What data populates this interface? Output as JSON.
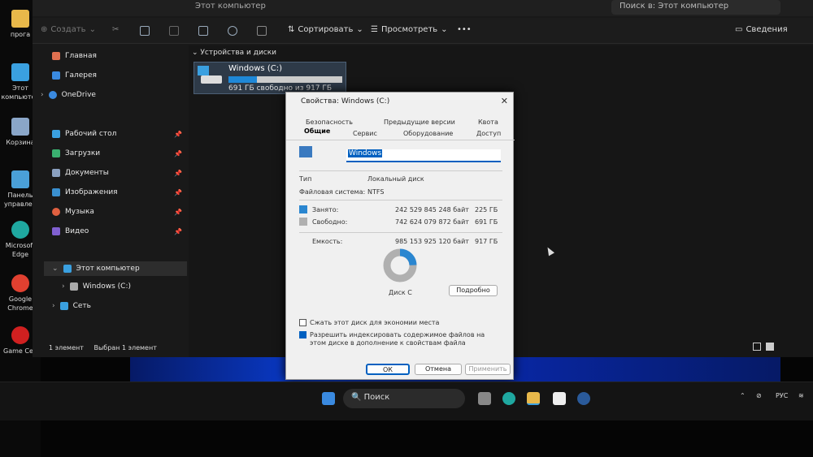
{
  "desktop": {
    "icons": [
      {
        "label": "прога",
        "icon": "folder-icon",
        "color": "#e8b84a"
      },
      {
        "label": "Этот компьютер",
        "icon": "computer-icon",
        "color": "#3aa0e0"
      },
      {
        "label": "Корзина",
        "icon": "recycle-bin-icon",
        "color": "#8aa6c8"
      },
      {
        "label": "Панель управлен",
        "icon": "control-panel-icon",
        "color": "#4aa0d8"
      },
      {
        "label": "Microsoft Edge",
        "icon": "edge-icon",
        "color": "#1fa8a0"
      },
      {
        "label": "Google Chrome",
        "icon": "chrome-icon",
        "color": "#e04030"
      },
      {
        "label": "Game Cen",
        "icon": "game-center-icon",
        "color": "#d02020"
      }
    ]
  },
  "explorer": {
    "title": "Этот компьютер",
    "search_placeholder": "Поиск в: Этот компьютер",
    "toolbar": {
      "create": "Создать",
      "sort": "Сортировать",
      "view": "Просмотреть",
      "more": "•••",
      "details": "Сведения"
    },
    "sidebar": {
      "items": [
        {
          "label": "Главная",
          "color": "#e07050"
        },
        {
          "label": "Галерея",
          "color": "#3a8ae0"
        },
        {
          "label": "OneDrive",
          "color": "#3a8ae0"
        },
        {
          "label": "Рабочий стол",
          "color": "#3aa0e0"
        },
        {
          "label": "Загрузки",
          "color": "#3ab070"
        },
        {
          "label": "Документы",
          "color": "#8aa0c0"
        },
        {
          "label": "Изображения",
          "color": "#3a90d0"
        },
        {
          "label": "Музыка",
          "color": "#e06040"
        },
        {
          "label": "Видео",
          "color": "#8060d0"
        },
        {
          "label": "Этот компьютер",
          "color": "#3aa0e0"
        },
        {
          "label": "Windows (C:)",
          "color": "#aaaaaa"
        },
        {
          "label": "Сеть",
          "color": "#3aa0e0"
        }
      ]
    },
    "section_title": "Устройства и диски",
    "drive": {
      "name": "Windows (C:)",
      "free_text": "691 ГБ свободно из 917 ГБ",
      "used_fraction": 0.25
    },
    "status": {
      "count": "1 элемент",
      "selected": "Выбран 1 элемент"
    }
  },
  "dialog": {
    "title": "Свойства: Windows (C:)",
    "tabs_row1": [
      "Безопасность",
      "Предыдущие версии",
      "Квота"
    ],
    "tabs_row2": [
      "Общие",
      "Сервис",
      "Оборудование",
      "Доступ"
    ],
    "name_value": "Windows",
    "type_label": "Тип",
    "type_value": "Локальный диск",
    "fs_label": "Файловая система:",
    "fs_value": "NTFS",
    "used_label": "Занято:",
    "used_bytes": "242 529 845 248 байт",
    "used_size": "225 ГБ",
    "free_label": "Свободно:",
    "free_bytes": "742 624 079 872 байт",
    "free_size": "691 ГБ",
    "capacity_label": "Емкость:",
    "capacity_bytes": "985 153 925 120 байт",
    "capacity_size": "917 ГБ",
    "disk_label": "Диск C",
    "cleanup_button": "Подробно",
    "compress_label": "Сжать этот диск для экономии места",
    "index_label": "Разрешить индексировать содержимое файлов на этом диске в дополнение к свойствам файла",
    "ok": "ОК",
    "cancel": "Отмена",
    "apply": "Применить",
    "used_color": "#2a86d0",
    "free_color": "#b0b0b0",
    "used_fraction": 0.246
  },
  "taskbar": {
    "search": "Поиск",
    "lang": "РУС"
  }
}
